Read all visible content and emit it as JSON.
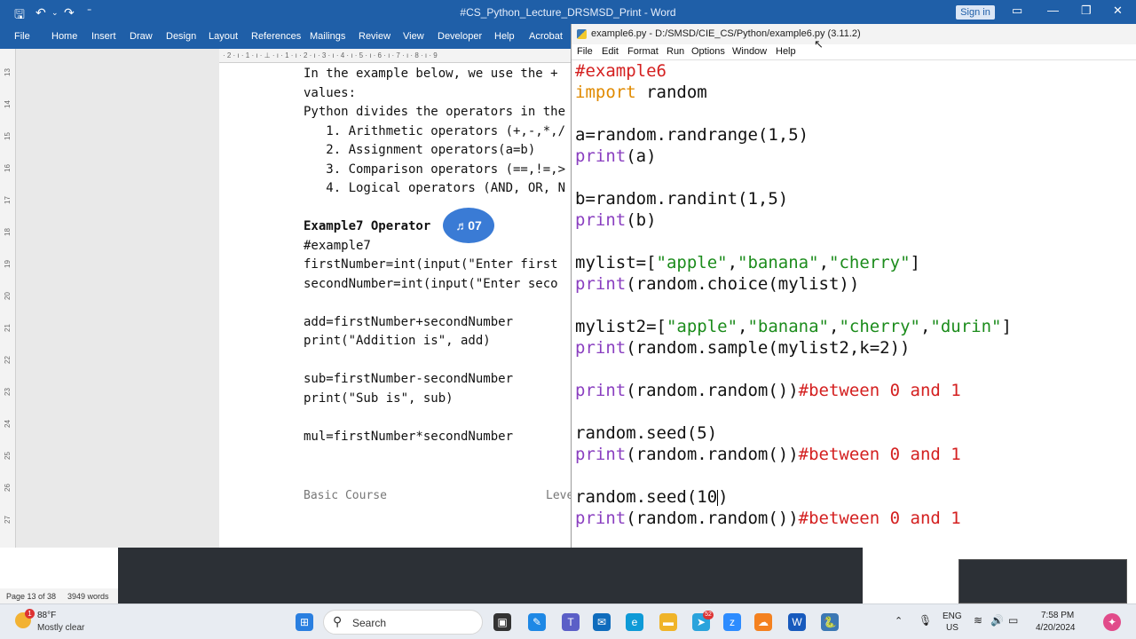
{
  "word": {
    "title": "#CS_Python_Lecture_DRSMSD_Print  -  Word",
    "signin": "Sign in",
    "qa_icons": [
      "save-icon",
      "undo-icon",
      "redo-icon",
      "customize-icon"
    ],
    "ribbon_tabs": [
      "File",
      "Home",
      "Insert",
      "Draw",
      "Design",
      "Layout",
      "References",
      "Mailings",
      "Review",
      "View",
      "Developer",
      "Help",
      "Acrobat"
    ],
    "ruler_text": "· 2 · ı · 1 · ı · ⊥ · ı · 1 · ı · 2 · ı · 3 · ı · 4 · ı · 5 · ı · 6 · ı · 7 · ı · 8 · ı · 9",
    "vruler_nums": [
      "13",
      "14",
      "15",
      "16",
      "17",
      "18",
      "19",
      "20",
      "21",
      "22",
      "23",
      "24",
      "25",
      "26",
      "27"
    ],
    "doc_lines": [
      "In the example below, we use the +",
      "values:",
      "Python divides the operators in the",
      "   1. Arithmetic operators (+,-,*,/",
      "   2. Assignment operators(a=b)",
      "   3. Comparison operators (==,!=,>",
      "   4. Logical operators (AND, OR, N",
      "",
      "Example7 Operator",
      "#example7",
      "firstNumber=int(input(\"Enter first",
      "secondNumber=int(input(\"Enter seco",
      "",
      "add=firstNumber+secondNumber",
      "print(\"Addition is\", add)",
      "",
      "sub=firstNumber-secondNumber",
      "print(\"Sub is\", sub)",
      "",
      "mul=firstNumber*secondNumber"
    ],
    "footer_left": "Basic Course",
    "footer_right": "Leve",
    "bubble": "♬07",
    "status": {
      "page": "Page 13 of 38",
      "words": "3949 words"
    }
  },
  "idle": {
    "title": "example6.py - D:/SMSD/CIE_CS/Python/example6.py (3.11.2)",
    "menu": [
      "File",
      "Edit",
      "Format",
      "Run",
      "Options",
      "Window",
      "Help"
    ],
    "lines": [
      [
        {
          "t": "#example6",
          "c": "cm"
        }
      ],
      [
        {
          "t": "import",
          "c": "kw"
        },
        {
          "t": " random",
          "c": ""
        }
      ],
      [],
      [
        {
          "t": "a=random.randrange(1,5)",
          "c": ""
        }
      ],
      [
        {
          "t": "print",
          "c": "bi"
        },
        {
          "t": "(a)",
          "c": ""
        }
      ],
      [],
      [
        {
          "t": "b=random.randint(1,5)",
          "c": ""
        }
      ],
      [
        {
          "t": "print",
          "c": "bi"
        },
        {
          "t": "(b)",
          "c": ""
        }
      ],
      [],
      [
        {
          "t": "mylist=[",
          "c": ""
        },
        {
          "t": "\"apple\"",
          "c": "st"
        },
        {
          "t": ",",
          "c": ""
        },
        {
          "t": "\"banana\"",
          "c": "st"
        },
        {
          "t": ",",
          "c": ""
        },
        {
          "t": "\"cherry\"",
          "c": "st"
        },
        {
          "t": "]",
          "c": ""
        }
      ],
      [
        {
          "t": "print",
          "c": "bi"
        },
        {
          "t": "(random.choice(mylist))",
          "c": ""
        }
      ],
      [],
      [
        {
          "t": "mylist2=[",
          "c": ""
        },
        {
          "t": "\"apple\"",
          "c": "st"
        },
        {
          "t": ",",
          "c": ""
        },
        {
          "t": "\"banana\"",
          "c": "st"
        },
        {
          "t": ",",
          "c": ""
        },
        {
          "t": "\"cherry\"",
          "c": "st"
        },
        {
          "t": ",",
          "c": ""
        },
        {
          "t": "\"durin\"",
          "c": "st"
        },
        {
          "t": "]",
          "c": ""
        }
      ],
      [
        {
          "t": "print",
          "c": "bi"
        },
        {
          "t": "(random.sample(mylist2,k=2))",
          "c": ""
        }
      ],
      [],
      [
        {
          "t": "print",
          "c": "bi"
        },
        {
          "t": "(random.random())",
          "c": ""
        },
        {
          "t": "#between 0 and 1",
          "c": "cm"
        }
      ],
      [],
      [
        {
          "t": "random.seed(5)",
          "c": ""
        }
      ],
      [
        {
          "t": "print",
          "c": "bi"
        },
        {
          "t": "(random.random())",
          "c": ""
        },
        {
          "t": "#between 0 and 1",
          "c": "cm"
        }
      ],
      [],
      [
        {
          "t": "random.seed(10",
          "c": ""
        },
        {
          "t": "|caret|",
          "c": "caret"
        },
        {
          "t": ")",
          "c": ""
        }
      ],
      [
        {
          "t": "print",
          "c": "bi"
        },
        {
          "t": "(random.random())",
          "c": ""
        },
        {
          "t": "#between 0 and 1",
          "c": "cm"
        }
      ]
    ]
  },
  "taskbar": {
    "weather_temp": "88°F",
    "weather_desc": "Mostly clear",
    "weather_badge": "1",
    "search_label": "Search",
    "lang1": "ENG",
    "lang2": "US",
    "time": "7:58 PM",
    "date": "4/20/2024",
    "telegram_badge": "52"
  }
}
